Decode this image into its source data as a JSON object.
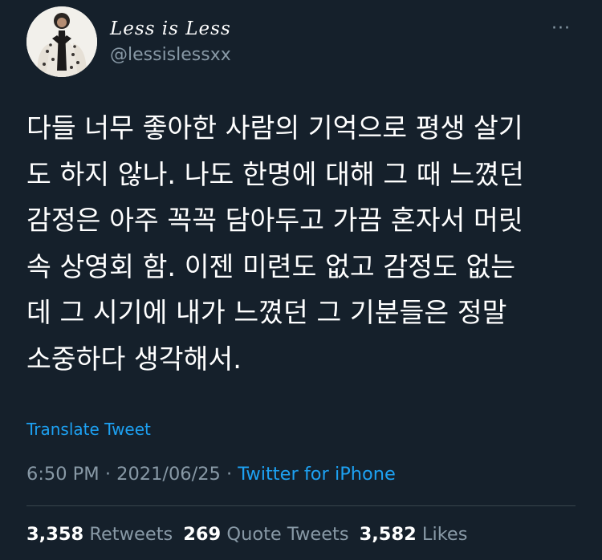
{
  "tweet": {
    "author": {
      "display_name": "Less is Less",
      "handle": "@lessislessxx"
    },
    "text": "다들 너무 좋아한 사람의 기억으로 평생 살기\n도 하지 않나. 나도 한명에 대해 그 때 느꼈던\n감정은 아주 꼭꼭 담아두고 가끔 혼자서 머릿\n속 상영회 함. 이젠 미련도 없고 감정도 없는\n데 그 시기에 내가 느꼈던 그 기분들은 정말\n소중하다 생각해서.",
    "translate_label": "Translate Tweet",
    "time": "6:50 PM",
    "separator": "·",
    "date": "2021/06/25",
    "source": "Twitter for iPhone",
    "more_icon": "···",
    "stats": {
      "retweets_count": "3,358",
      "retweets_label": "Retweets",
      "quote_count": "269",
      "quote_label": "Quote Tweets",
      "likes_count": "3,582",
      "likes_label": "Likes"
    }
  },
  "colors": {
    "background": "#15202b",
    "text": "#ffffff",
    "secondary": "#8899a6",
    "accent": "#1da1f2",
    "divider": "#38444d"
  }
}
